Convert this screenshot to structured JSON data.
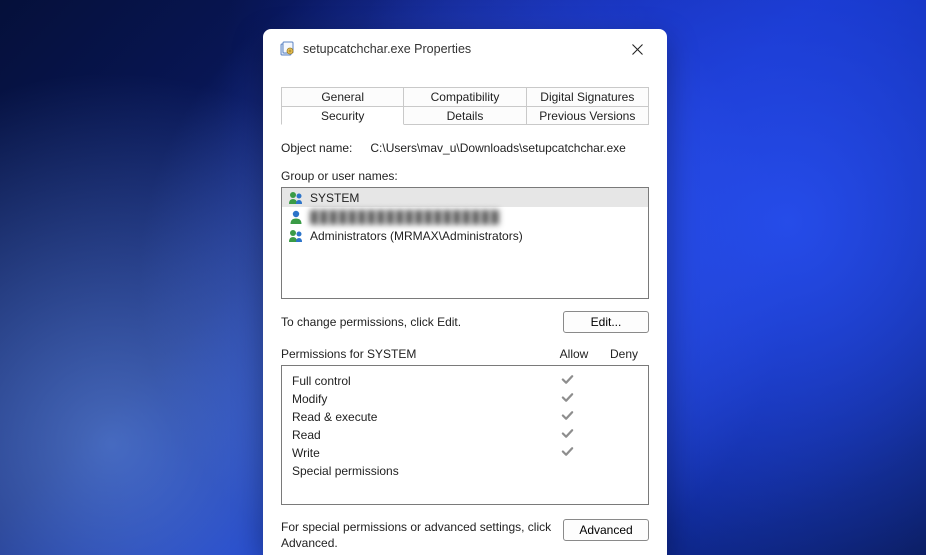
{
  "window": {
    "title": "setupcatchchar.exe Properties"
  },
  "tabs": {
    "row1": [
      "General",
      "Compatibility",
      "Digital Signatures"
    ],
    "row2": [
      "Security",
      "Details",
      "Previous Versions"
    ],
    "active": "Security"
  },
  "object": {
    "label": "Object name:",
    "value": "C:\\Users\\mav_u\\Downloads\\setupcatchchar.exe"
  },
  "groups": {
    "label": "Group or user names:",
    "items": [
      {
        "name": "SYSTEM",
        "selected": true,
        "redacted": false
      },
      {
        "name": "████████████████████",
        "selected": false,
        "redacted": true
      },
      {
        "name": "Administrators (MRMAX\\Administrators)",
        "selected": false,
        "redacted": false
      }
    ]
  },
  "edit": {
    "hint": "To change permissions, click Edit.",
    "button": "Edit..."
  },
  "permissions": {
    "header_for": "Permissions for SYSTEM",
    "col_allow": "Allow",
    "col_deny": "Deny",
    "rows": [
      {
        "name": "Full control",
        "allow": true,
        "deny": false
      },
      {
        "name": "Modify",
        "allow": true,
        "deny": false
      },
      {
        "name": "Read & execute",
        "allow": true,
        "deny": false
      },
      {
        "name": "Read",
        "allow": true,
        "deny": false
      },
      {
        "name": "Write",
        "allow": true,
        "deny": false
      },
      {
        "name": "Special permissions",
        "allow": false,
        "deny": false
      }
    ]
  },
  "advanced": {
    "hint": "For special permissions or advanced settings, click Advanced.",
    "button": "Advanced"
  }
}
